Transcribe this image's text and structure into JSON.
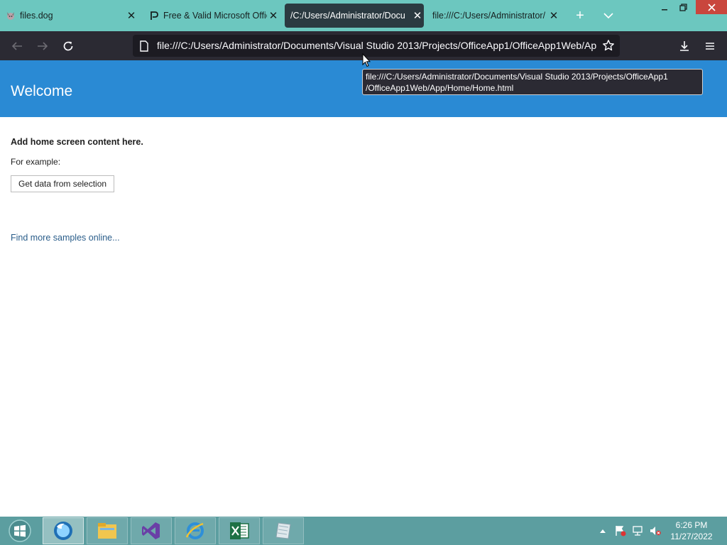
{
  "browser": {
    "tabs": [
      {
        "title": "files.dog",
        "favicon": "dog-favicon-icon",
        "active": false
      },
      {
        "title": "Free & Valid Microsoft Offic",
        "favicon": "p-logo-icon",
        "active": false
      },
      {
        "title": "/C:/Users/Administrator/Docu",
        "favicon": "",
        "active": true
      },
      {
        "title": "file:///C:/Users/Administrator/",
        "favicon": "",
        "active": false
      }
    ],
    "url": "file:///C:/Users/Administrator/Documents/Visual Studio 2013/Projects/OfficeApp1/OfficeApp1Web/App/Home/Home.html",
    "tooltip_line1": "file:///C:/Users/Administrator/Documents/Visual Studio 2013/Projects/OfficeApp1",
    "tooltip_line2": "/OfficeApp1Web/App/Home/Home.html",
    "colors": {
      "tabstrip": "#6cc7bf",
      "toolbar": "#2b2a33",
      "accent_band": "#2a8ad4",
      "close_button": "#c9463d"
    }
  },
  "page": {
    "title": "Welcome",
    "heading": "Add home screen content here.",
    "example_label": "For example:",
    "button_label": "Get data from selection",
    "samples_link": "Find more samples online..."
  },
  "taskbar": {
    "apps": [
      {
        "name": "firefox-icon",
        "active": true
      },
      {
        "name": "file-explorer-icon",
        "active": false
      },
      {
        "name": "visual-studio-icon",
        "active": false
      },
      {
        "name": "internet-explorer-icon",
        "active": false
      },
      {
        "name": "excel-icon",
        "active": false
      },
      {
        "name": "app-paper-icon",
        "active": false
      }
    ],
    "time": "6:26 PM",
    "date": "11/27/2022"
  }
}
